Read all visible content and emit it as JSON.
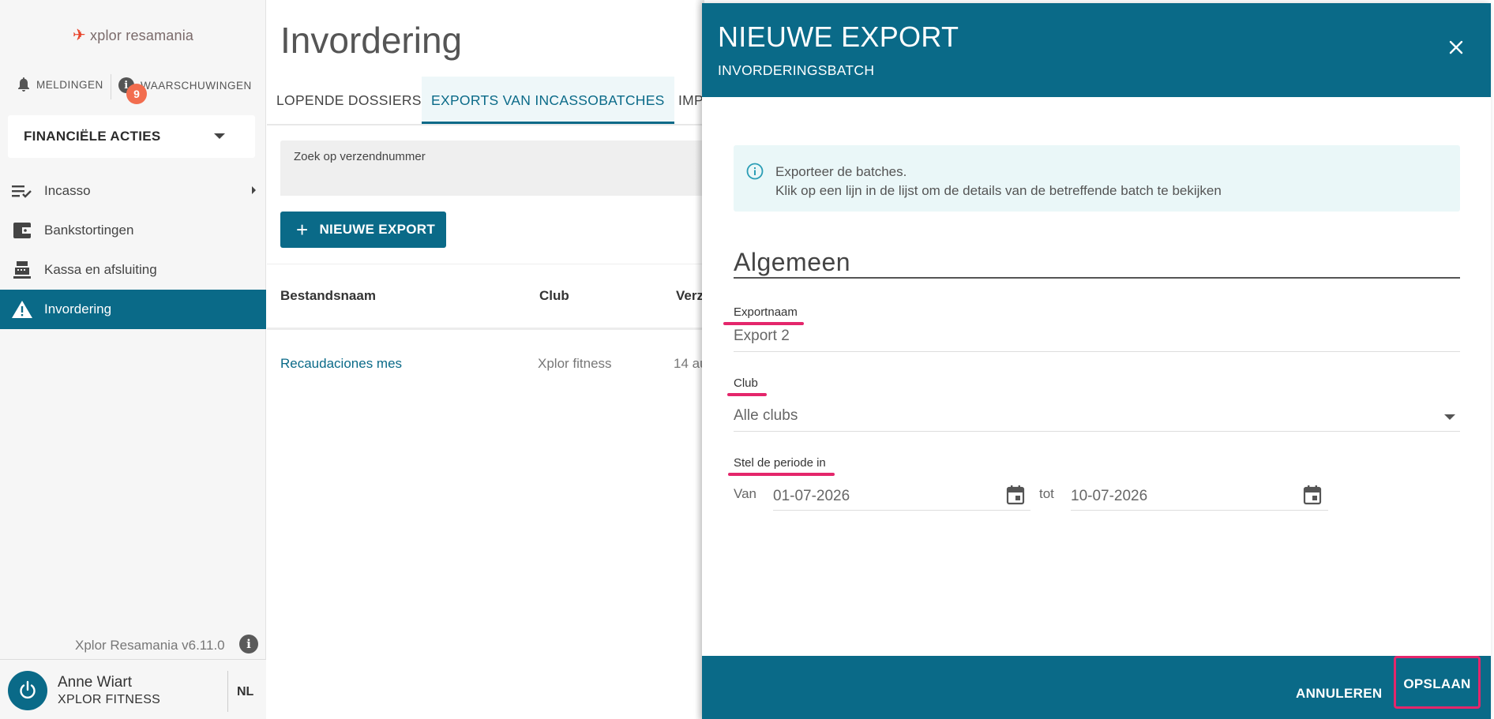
{
  "sidebar": {
    "logo_text": "xplor resamania",
    "notifications_label": "MELDINGEN",
    "warnings_label": "WAARSCHUWINGEN",
    "warnings_count": "9",
    "section_select": "FINANCIËLE ACTIES",
    "items": [
      {
        "label": "Incasso",
        "icon": "checklist-icon"
      },
      {
        "label": "Bankstortingen",
        "icon": "wallet-icon"
      },
      {
        "label": "Kassa en afsluiting",
        "icon": "cash-register-icon"
      },
      {
        "label": "Invordering",
        "icon": "warning-icon"
      }
    ],
    "version": "Xplor Resamania v6.11.0",
    "user": {
      "name": "Anne Wiart",
      "club": "XPLOR FITNESS",
      "lang": "NL"
    }
  },
  "main": {
    "title": "Invordering",
    "tabs": [
      "LOPENDE DOSSIERS",
      "EXPORTS VAN INCASSOBATCHES",
      "IMP"
    ],
    "search_label": "Zoek op verzendnummer",
    "new_export_button": "NIEUWE EXPORT",
    "columns": [
      "Bestandsnaam",
      "Club",
      "Verz"
    ],
    "rows": [
      {
        "file": "Recaudaciones mes",
        "club": "Xplor fitness",
        "date": "14 au"
      }
    ]
  },
  "dialog": {
    "title": "NIEUWE EXPORT",
    "subtitle": "INVORDERINGSBATCH",
    "info_line1": "Exporteer de batches.",
    "info_line2": "Klik op een lijn in de lijst om de details van de betreffende batch te bekijken",
    "section": "Algemeen",
    "export_name_label": "Exportnaam",
    "export_name_value": "Export 2",
    "club_label": "Club",
    "club_value": "Alle clubs",
    "period_label": "Stel de periode in",
    "from_label": "Van",
    "from_value": "01-07-2026",
    "to_label": "tot",
    "to_value": "10-07-2026",
    "cancel_button": "ANNULEREN",
    "save_button": "OPSLAAN"
  },
  "colors": {
    "primary": "#0a6a88",
    "highlight": "#e4266b",
    "badge": "#f26d4f"
  }
}
